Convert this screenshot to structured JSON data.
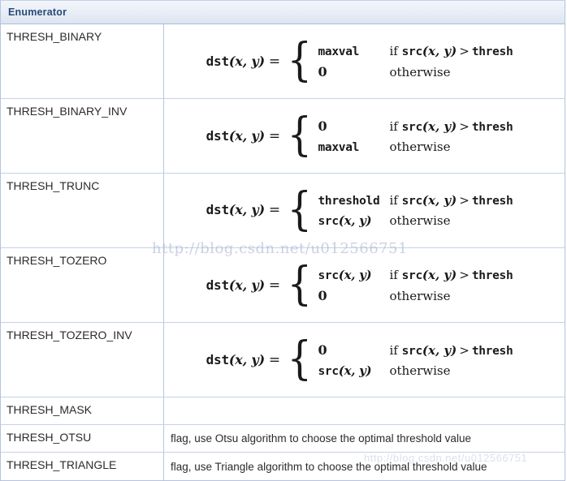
{
  "table": {
    "header": {
      "enumerator_label": "Enumerator"
    },
    "rows": [
      {
        "name": "THRESH_BINARY",
        "kind": "formula",
        "formula": {
          "lhs_fn": "dst",
          "lhs_args": "(x, y)",
          "equals": "=",
          "cases": [
            {
              "value": "maxval",
              "value_style": "mono",
              "condition_prefix": "if",
              "condition_fn": "src",
              "condition_args": "(x, y)",
              "condition_op": ">",
              "condition_rhs": "thresh"
            },
            {
              "value": "0",
              "value_style": "num",
              "condition_text": "otherwise"
            }
          ]
        }
      },
      {
        "name": "THRESH_BINARY_INV",
        "kind": "formula",
        "formula": {
          "lhs_fn": "dst",
          "lhs_args": "(x, y)",
          "equals": "=",
          "cases": [
            {
              "value": "0",
              "value_style": "num",
              "condition_prefix": "if",
              "condition_fn": "src",
              "condition_args": "(x, y)",
              "condition_op": ">",
              "condition_rhs": "thresh"
            },
            {
              "value": "maxval",
              "value_style": "mono",
              "condition_text": "otherwise"
            }
          ]
        }
      },
      {
        "name": "THRESH_TRUNC",
        "kind": "formula",
        "formula": {
          "lhs_fn": "dst",
          "lhs_args": "(x, y)",
          "equals": "=",
          "cases": [
            {
              "value": "threshold",
              "value_style": "mono",
              "condition_prefix": "if",
              "condition_fn": "src",
              "condition_args": "(x, y)",
              "condition_op": ">",
              "condition_rhs": "thresh"
            },
            {
              "value": "src",
              "value_style": "fn",
              "value_args": "(x, y)",
              "condition_text": "otherwise"
            }
          ]
        }
      },
      {
        "name": "THRESH_TOZERO",
        "kind": "formula",
        "formula": {
          "lhs_fn": "dst",
          "lhs_args": "(x, y)",
          "equals": "=",
          "cases": [
            {
              "value": "src",
              "value_style": "fn",
              "value_args": "(x, y)",
              "condition_prefix": "if",
              "condition_fn": "src",
              "condition_args": "(x, y)",
              "condition_op": ">",
              "condition_rhs": "thresh"
            },
            {
              "value": "0",
              "value_style": "num",
              "condition_text": "otherwise"
            }
          ]
        }
      },
      {
        "name": "THRESH_TOZERO_INV",
        "kind": "formula",
        "formula": {
          "lhs_fn": "dst",
          "lhs_args": "(x, y)",
          "equals": "=",
          "cases": [
            {
              "value": "0",
              "value_style": "num",
              "condition_prefix": "if",
              "condition_fn": "src",
              "condition_args": "(x, y)",
              "condition_op": ">",
              "condition_rhs": "thresh"
            },
            {
              "value": "src",
              "value_style": "fn",
              "value_args": "(x, y)",
              "condition_text": "otherwise"
            }
          ]
        }
      },
      {
        "name": "THRESH_MASK",
        "kind": "plain",
        "description": ""
      },
      {
        "name": "THRESH_OTSU",
        "kind": "plain",
        "description": "flag, use Otsu algorithm to choose the optimal threshold value"
      },
      {
        "name": "THRESH_TRIANGLE",
        "kind": "plain",
        "description": "flag, use Triangle algorithm to choose the optimal threshold value"
      }
    ]
  },
  "watermarks": {
    "middle": "http://blog.csdn.net/u012566751",
    "bottom": "http://blog.csdn.net/u012566751"
  },
  "colors": {
    "header_text": "#294a78",
    "header_bg_top": "#f2f5fa",
    "header_bg_bottom": "#dde5f1",
    "border": "#b6c4de",
    "row_divider": "#c5d1e6",
    "body_text": "#2b2b2b",
    "watermark": "#aab6d2"
  }
}
